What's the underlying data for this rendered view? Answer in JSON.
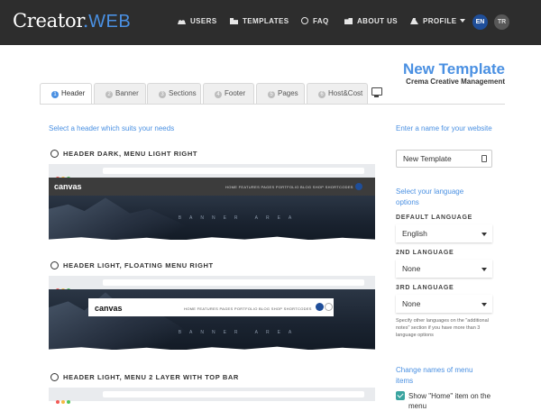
{
  "app": {
    "logo_main": "Creator",
    "logo_dot": ".",
    "logo_accent": "WEB"
  },
  "nav": {
    "users": "USERS",
    "templates": "TEMPLATES",
    "faq": "FAQ",
    "about": "ABOUT US",
    "profile": "PROFILE",
    "lang_en": "EN",
    "lang_tr": "TR"
  },
  "page": {
    "title": "New Template",
    "subtitle": "Crema Creative Management"
  },
  "tabs": [
    {
      "num": "1",
      "label": "Header",
      "active": true
    },
    {
      "num": "2",
      "label": "Banner"
    },
    {
      "num": "3",
      "label": "Sections"
    },
    {
      "num": "4",
      "label": "Footer"
    },
    {
      "num": "5",
      "label": "Pages"
    },
    {
      "num": "6",
      "label": "Host&Cost"
    }
  ],
  "left": {
    "hint": "Select a header which suits your needs",
    "options": [
      {
        "label": "HEADER DARK, MENU LIGHT RIGHT"
      },
      {
        "label": "HEADER LIGHT, FLOATING MENU RIGHT"
      },
      {
        "label": "HEADER LIGHT, MENU 2 LAYER WITH TOP BAR"
      }
    ],
    "preview": {
      "logo": "canvas",
      "menu": "HOME   FEATURES   PAGES   PORTFOLIO   BLOG   SHOP   SHORTCODES",
      "banner": "BANNER AREA"
    }
  },
  "right": {
    "name_label": "Enter a name for your website",
    "name_value": "New Template",
    "lang_label": "Select your language options",
    "default_lang_label": "DEFAULT LANGUAGE",
    "default_lang_value": "English",
    "second_lang_label": "2ND LANGUAGE",
    "second_lang_value": "None",
    "third_lang_label": "3RD LANGUAGE",
    "third_lang_value": "None",
    "note": "Specify other languages on the \"additional notes\" section if you have more than 3 language options",
    "menu_names_label": "Change names of menu items",
    "show_home_label": "Show \"Home\" item on the menu"
  },
  "colors": {
    "accent": "#4a90e2",
    "topbar": "#2d2d2d",
    "check": "#3aa4a0"
  }
}
